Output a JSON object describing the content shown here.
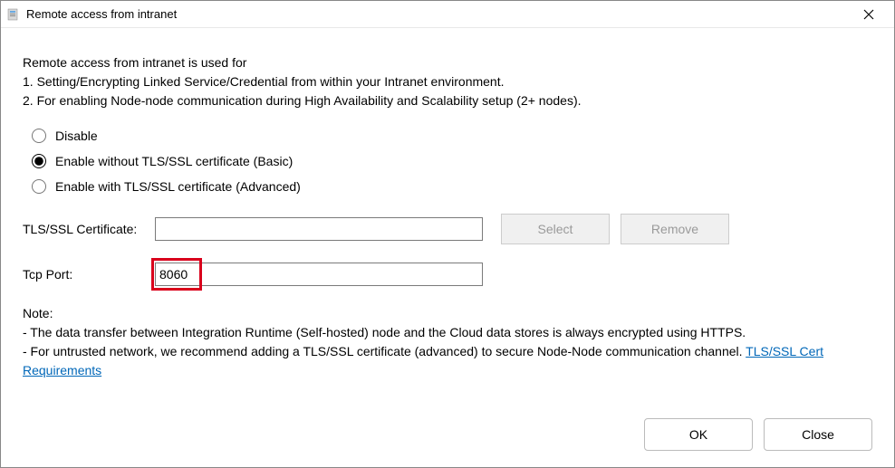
{
  "window": {
    "title": "Remote access from intranet"
  },
  "intro": {
    "line0": "Remote access from intranet is used for",
    "line1": "1. Setting/Encrypting Linked Service/Credential from within your Intranet environment.",
    "line2": "2. For enabling Node-node communication during High Availability and Scalability setup (2+ nodes)."
  },
  "options": {
    "disable": "Disable",
    "basic": "Enable without TLS/SSL certificate (Basic)",
    "advanced": "Enable with TLS/SSL certificate (Advanced)",
    "selected": "basic"
  },
  "cert": {
    "label": "TLS/SSL Certificate:",
    "value": "",
    "select_btn": "Select",
    "remove_btn": "Remove"
  },
  "port": {
    "label": "Tcp Port:",
    "value": "8060"
  },
  "note": {
    "heading": "Note:",
    "line1": " - The data transfer between Integration Runtime (Self-hosted) node and the Cloud data stores is always encrypted using HTTPS.",
    "line2_prefix": " - For untrusted network, we recommend adding a TLS/SSL certificate (advanced) to secure Node-Node communication channel. ",
    "link": "TLS/SSL Cert Requirements"
  },
  "footer": {
    "ok": "OK",
    "close": "Close"
  }
}
